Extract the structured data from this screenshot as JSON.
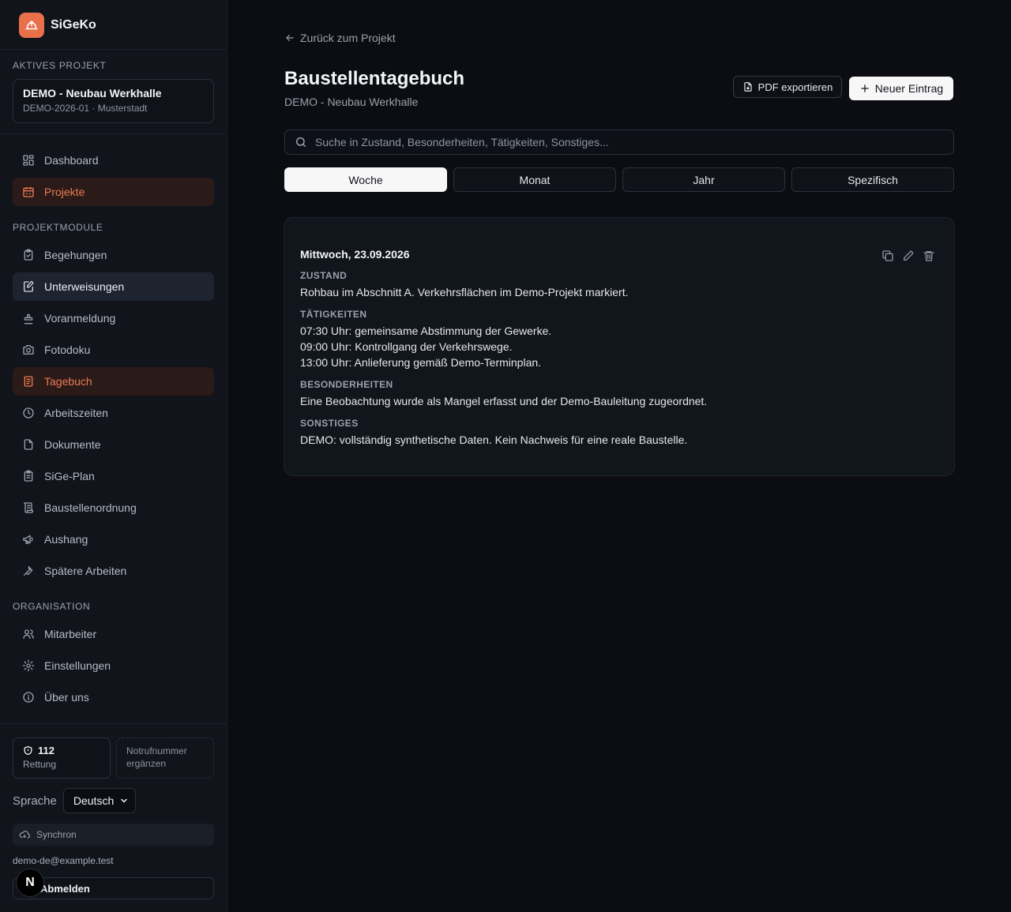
{
  "brand": {
    "name": "SiGeKo",
    "logo_icon": "hardhat-icon",
    "color": "#e8704b"
  },
  "active_project": {
    "section_label": "AKTIVES PROJEKT",
    "name": "DEMO - Neubau Werkhalle",
    "meta": "DEMO-2026-01 · Musterstadt"
  },
  "nav_top": [
    {
      "label": "Dashboard",
      "icon": "dashboard-icon"
    },
    {
      "label": "Projekte",
      "icon": "calendar-icon",
      "state": "active"
    }
  ],
  "module_section_label": "PROJEKTMODULE",
  "nav_modules": [
    {
      "label": "Begehungen",
      "icon": "clipboard-check-icon"
    },
    {
      "label": "Unterweisungen",
      "icon": "edit-file-icon",
      "state": "hover"
    },
    {
      "label": "Voranmeldung",
      "icon": "stamp-icon"
    },
    {
      "label": "Fotodoku",
      "icon": "camera-icon"
    },
    {
      "label": "Tagebuch",
      "icon": "notebook-icon",
      "state": "active"
    },
    {
      "label": "Arbeitszeiten",
      "icon": "clock-icon"
    },
    {
      "label": "Dokumente",
      "icon": "file-icon"
    },
    {
      "label": "SiGe-Plan",
      "icon": "clipboard-list-icon"
    },
    {
      "label": "Baustellenordnung",
      "icon": "scroll-icon"
    },
    {
      "label": "Aushang",
      "icon": "megaphone-icon"
    },
    {
      "label": "Spätere Arbeiten",
      "icon": "wrench-icon"
    }
  ],
  "org_section_label": "ORGANISATION",
  "nav_org": [
    {
      "label": "Mitarbeiter",
      "icon": "users-icon"
    },
    {
      "label": "Einstellungen",
      "icon": "gear-icon"
    },
    {
      "label": "Über uns",
      "icon": "info-icon"
    }
  ],
  "emergency": {
    "number": "112",
    "label": "Rettung",
    "placeholder_text": "Notrufnummer ergänzen"
  },
  "language": {
    "label": "Sprache",
    "selected": "Deutsch"
  },
  "sync_status": "Synchron",
  "user_email": "demo-de@example.test",
  "logout_label": "Abmelden",
  "next_badge": "N",
  "main": {
    "back_link": "Zurück zum Projekt",
    "title": "Baustellentagebuch",
    "subtitle": "DEMO - Neubau Werkhalle",
    "export_button": "PDF exportieren",
    "new_entry_button": "Neuer Eintrag",
    "search_placeholder": "Suche in Zustand, Besonderheiten, Tätigkeiten, Sonstiges...",
    "tabs": [
      {
        "label": "Woche",
        "active": true
      },
      {
        "label": "Monat"
      },
      {
        "label": "Jahr"
      },
      {
        "label": "Spezifisch"
      }
    ],
    "entry": {
      "date": "Mittwoch, 23.09.2026",
      "zustand_label": "ZUSTAND",
      "zustand": "Rohbau im Abschnitt A. Verkehrsflächen im Demo-Projekt markiert.",
      "taetigkeiten_label": "TÄTIGKEITEN",
      "taetigkeiten": [
        "07:30 Uhr: gemeinsame Abstimmung der Gewerke.",
        "09:00 Uhr: Kontrollgang der Verkehrswege.",
        "13:00 Uhr: Anlieferung gemäß Demo-Terminplan."
      ],
      "besonderheiten_label": "BESONDERHEITEN",
      "besonderheiten": "Eine Beobachtung wurde als Mangel erfasst und der Demo-Bauleitung zugeordnet.",
      "sonstiges_label": "SONSTIGES",
      "sonstiges": "DEMO: vollständig synthetische Daten. Kein Nachweis für eine reale Baustelle."
    }
  },
  "colors": {
    "background": "#0b0d12",
    "sidebar": "#11141b",
    "accent_orange": "#ee7b53",
    "active_orange_bg": "#2a1a18",
    "active_blue_bg": "#1e2330"
  }
}
